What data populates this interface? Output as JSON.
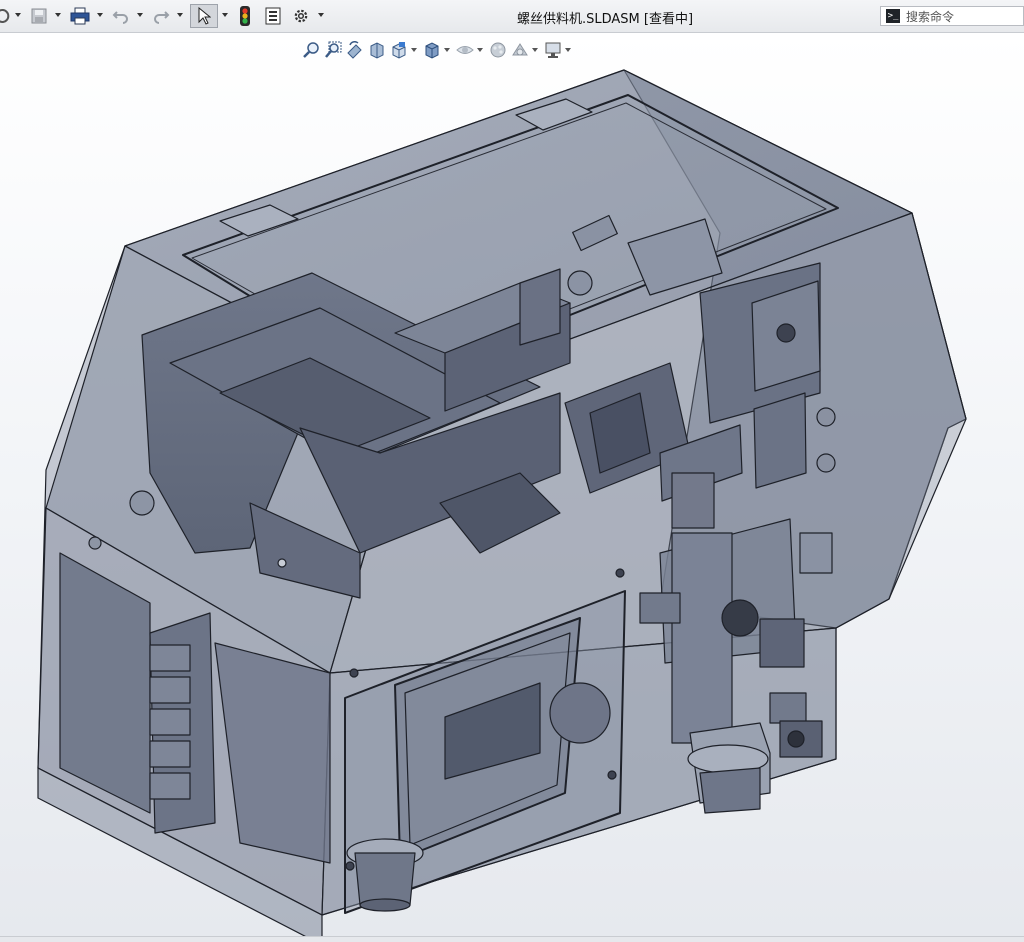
{
  "window": {
    "title": "螺丝供料机.SLDASM [查看中]"
  },
  "toolbar": {
    "items": [
      "rebuild-icon",
      "save-icon",
      "print-icon",
      "undo-icon",
      "redo-icon",
      "select-icon",
      "traffic-light-icon",
      "file-properties-icon",
      "options-icon"
    ]
  },
  "search": {
    "placeholder": "搜索命令"
  },
  "heads_up_toolbar": {
    "items": [
      "zoom-to-fit-icon",
      "zoom-to-area-icon",
      "previous-view-icon",
      "section-view-icon",
      "view-orientation-icon",
      "display-style-icon",
      "hide-show-items-icon",
      "edit-appearance-icon",
      "apply-scene-icon",
      "view-settings-icon"
    ]
  },
  "colors": {
    "housing_glass": "#7d8698",
    "parts": "#5f6678",
    "edge": "#1e2129",
    "viewport_bg_top": "#ffffff",
    "viewport_bg_bottom": "#e6e9ee"
  }
}
